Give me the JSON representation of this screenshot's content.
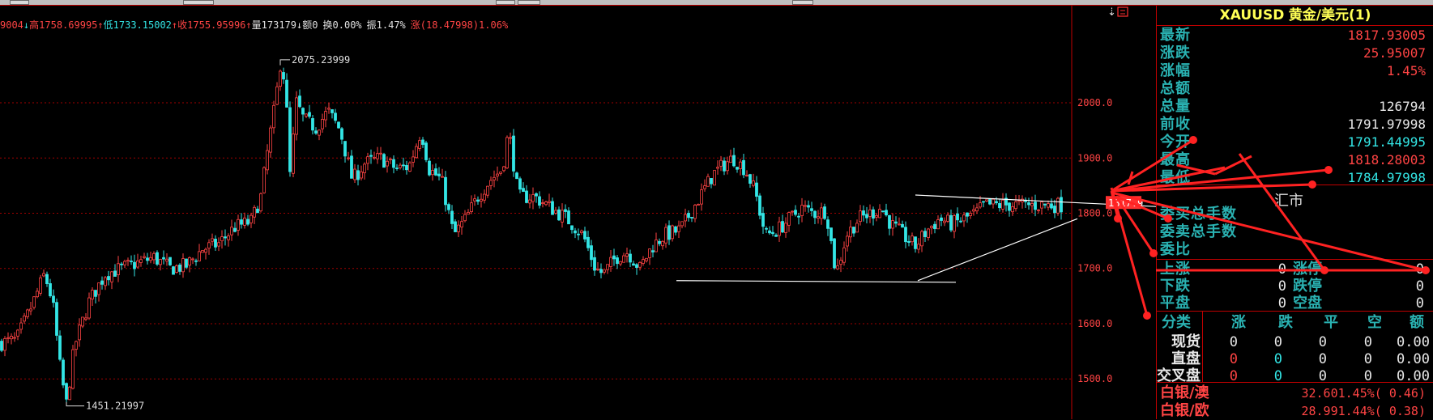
{
  "stats": {
    "prefix": "9004",
    "arrow_down_1": "↓",
    "high_label": "高",
    "high_value": "1758.69995",
    "arrow_up_1": "↑",
    "low_label": "低",
    "low_value": "1733.15002",
    "arrow_up_2": "↑",
    "close_label": "收",
    "close_value": "1755.95996",
    "arrow_up_3": "↑",
    "vol_label": "量",
    "vol_value": "173179",
    "arrow_down_2": "↓",
    "amount_label": "额",
    "amount_value": "0",
    "turnover_label": "换",
    "turnover_value": "0.00%",
    "amp_label": "振",
    "amp_value": "1.47%",
    "chg_label": "涨",
    "chg_value": "(18.47998)1.06%"
  },
  "chart_data": {
    "type": "candlestick",
    "y_ticks": [
      "2000.0",
      "1900.0",
      "1800.0",
      "1700.0",
      "1600.0",
      "1500.0"
    ],
    "y_tick_values": [
      2000,
      1900,
      1800,
      1700,
      1600,
      1500
    ],
    "ylim": [
      1449,
      2110
    ],
    "annotations": {
      "max_label": "2075.23999",
      "min_label": "1451.21997",
      "current_price_tag": "1817.9"
    },
    "price_path": [
      [
        0,
        1565
      ],
      [
        20,
        1570
      ],
      [
        40,
        1635
      ],
      [
        55,
        1690
      ],
      [
        65,
        1640
      ],
      [
        75,
        1510
      ],
      [
        82,
        1455
      ],
      [
        92,
        1560
      ],
      [
        110,
        1640
      ],
      [
        130,
        1690
      ],
      [
        150,
        1700
      ],
      [
        170,
        1710
      ],
      [
        190,
        1720
      ],
      [
        210,
        1700
      ],
      [
        230,
        1705
      ],
      [
        250,
        1735
      ],
      [
        270,
        1745
      ],
      [
        290,
        1775
      ],
      [
        310,
        1785
      ],
      [
        322,
        1830
      ],
      [
        332,
        1930
      ],
      [
        340,
        2000
      ],
      [
        346,
        2070
      ],
      [
        352,
        2040
      ],
      [
        358,
        1870
      ],
      [
        366,
        2000
      ],
      [
        375,
        1970
      ],
      [
        390,
        1955
      ],
      [
        405,
        1985
      ],
      [
        420,
        1950
      ],
      [
        435,
        1860
      ],
      [
        450,
        1890
      ],
      [
        470,
        1900
      ],
      [
        490,
        1880
      ],
      [
        505,
        1885
      ],
      [
        520,
        1950
      ],
      [
        530,
        1880
      ],
      [
        545,
        1860
      ],
      [
        560,
        1760
      ],
      [
        575,
        1790
      ],
      [
        590,
        1830
      ],
      [
        605,
        1860
      ],
      [
        620,
        1880
      ],
      [
        628,
        1950
      ],
      [
        640,
        1830
      ],
      [
        660,
        1830
      ],
      [
        680,
        1810
      ],
      [
        700,
        1790
      ],
      [
        720,
        1760
      ],
      [
        735,
        1700
      ],
      [
        745,
        1690
      ],
      [
        760,
        1720
      ],
      [
        775,
        1730
      ],
      [
        790,
        1700
      ],
      [
        805,
        1740
      ],
      [
        820,
        1760
      ],
      [
        840,
        1770
      ],
      [
        860,
        1820
      ],
      [
        880,
        1870
      ],
      [
        895,
        1890
      ],
      [
        905,
        1900
      ],
      [
        920,
        1880
      ],
      [
        932,
        1840
      ],
      [
        945,
        1760
      ],
      [
        960,
        1770
      ],
      [
        975,
        1790
      ],
      [
        990,
        1810
      ],
      [
        1005,
        1800
      ],
      [
        1020,
        1805
      ],
      [
        1032,
        1690
      ],
      [
        1045,
        1760
      ],
      [
        1060,
        1790
      ],
      [
        1075,
        1800
      ],
      [
        1088,
        1810
      ],
      [
        1100,
        1780
      ],
      [
        1115,
        1760
      ],
      [
        1130,
        1740
      ],
      [
        1145,
        1770
      ],
      [
        1160,
        1790
      ],
      [
        1175,
        1780
      ],
      [
        1190,
        1790
      ],
      [
        1205,
        1800
      ],
      [
        1215,
        1815
      ]
    ]
  },
  "panel": {
    "symbol": "XAUUSD",
    "name": "黄金/美元(1)",
    "quote_rows": [
      {
        "label": "最新",
        "value": "1817.93005",
        "color": "red"
      },
      {
        "label": "涨跌",
        "value": "25.95007",
        "color": "red"
      },
      {
        "label": "涨幅",
        "value": "1.45%",
        "color": "red"
      },
      {
        "label": "总额",
        "value": "",
        "color": "white"
      },
      {
        "label": "总量",
        "value": "126794",
        "color": "white"
      },
      {
        "label": "前收",
        "value": "1791.97998",
        "color": "white"
      },
      {
        "label": "今开",
        "value": "1791.44995",
        "color": "cyan"
      },
      {
        "label": "最高",
        "value": "1818.28003",
        "color": "red"
      },
      {
        "label": "最低",
        "value": "1784.97998",
        "color": "cyan"
      }
    ],
    "market_label": "汇市",
    "order_rows": [
      {
        "label": "委买总手数"
      },
      {
        "label": "委卖总手数"
      },
      {
        "label": "委比"
      }
    ],
    "updown_rows": [
      {
        "left_label": "上涨",
        "left_value": "0",
        "right_label": "涨停",
        "right_value": "0"
      },
      {
        "left_label": "下跌",
        "left_value": "0",
        "right_label": "跌停",
        "right_value": "0"
      },
      {
        "left_label": "平盘",
        "left_value": "0",
        "right_label": "空盘",
        "right_value": "0"
      }
    ],
    "table_headers": [
      "分类",
      "涨",
      "跌",
      "平",
      "空",
      "额"
    ],
    "table_rows": [
      {
        "name": "现货",
        "up": "0",
        "down": "0",
        "flat": "0",
        "empty": "0",
        "amount": "0.00",
        "style": "white"
      },
      {
        "name": "直盘",
        "up": "0",
        "down": "0",
        "flat": "0",
        "empty": "0",
        "amount": "0.00",
        "style": "colored"
      },
      {
        "name": "交叉盘",
        "up": "0",
        "down": "0",
        "flat": "0",
        "empty": "0",
        "amount": "0.00",
        "style": "colored"
      }
    ],
    "bottom_rows": [
      {
        "name": "白银/澳",
        "value": "32.601.45%( 0.46)"
      },
      {
        "name": "白银/欧",
        "value": "28.991.44%( 0.38)"
      }
    ]
  },
  "colors": {
    "up": "#ff4444",
    "down": "#33e6e6",
    "grid": "#a00000",
    "arrow": "#ff2222"
  }
}
